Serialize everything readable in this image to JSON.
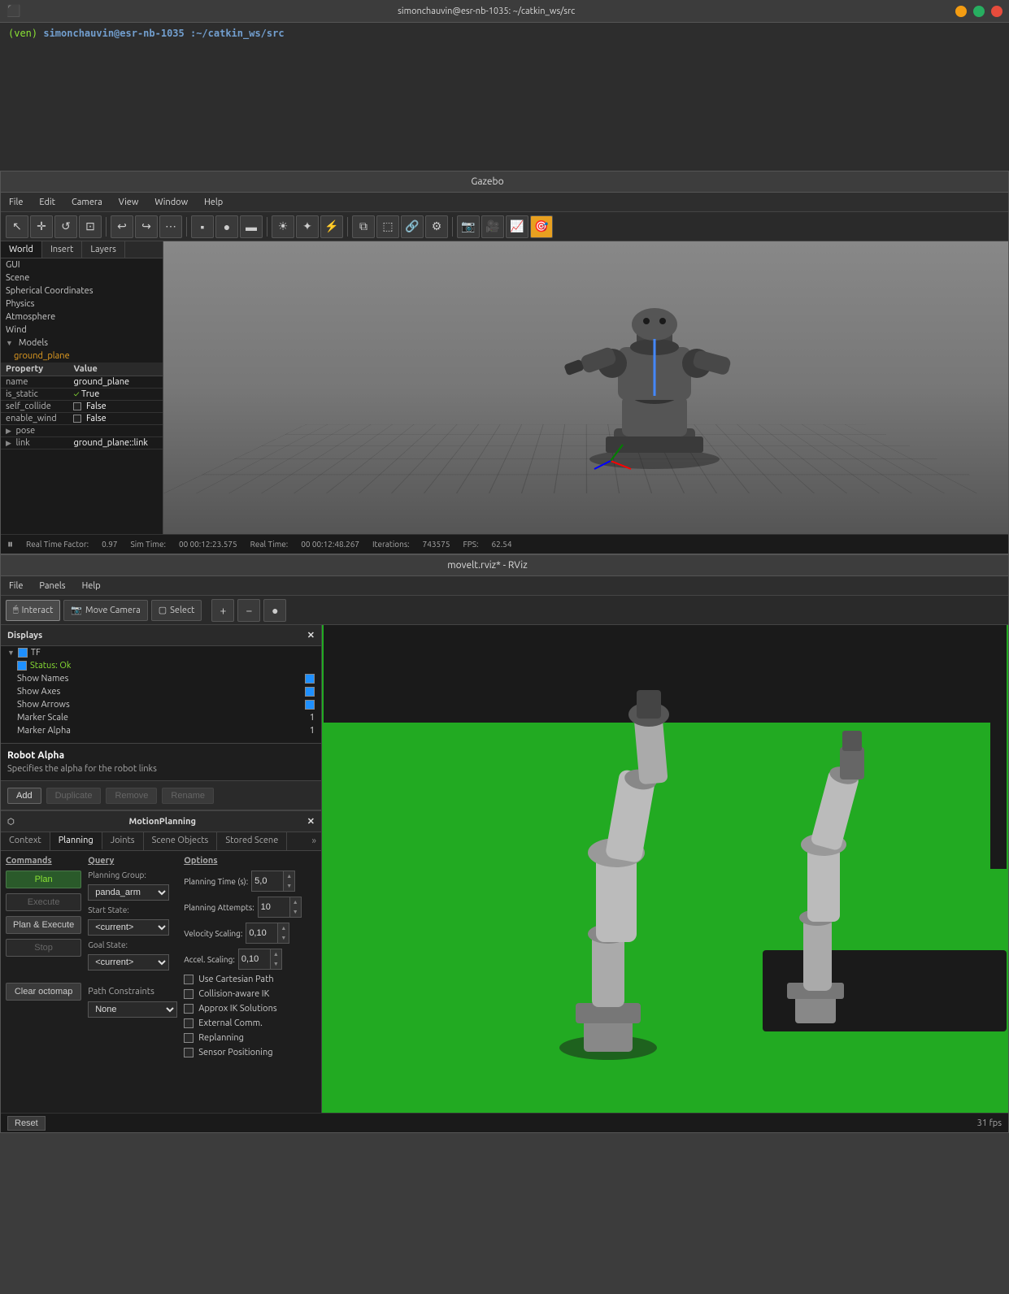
{
  "terminal": {
    "title": "simonchauvin@esr-nb-1035: ~/catkin_ws/src",
    "prompt": "(ven)",
    "user_host": "simonchauvin@esr-nb-1035",
    "path": ":~/catkin_ws/src",
    "cursor": "$"
  },
  "gazebo": {
    "title": "Gazebo",
    "menu": [
      "File",
      "Edit",
      "Camera",
      "View",
      "Window",
      "Help"
    ],
    "tabs": [
      "World",
      "Insert",
      "Layers"
    ],
    "tree": {
      "gui": "GUI",
      "scene": "Scene",
      "spherical_coordinates": "Spherical Coordinates",
      "physics": "Physics",
      "atmosphere": "Atmosphere",
      "wind": "Wind",
      "models": "Models",
      "ground_plane": "ground_plane"
    },
    "properties": {
      "header": [
        "Property",
        "Value"
      ],
      "rows": [
        {
          "prop": "name",
          "val": "ground_plane"
        },
        {
          "prop": "is_static",
          "val": "True",
          "checked": true
        },
        {
          "prop": "self_collide",
          "val": "False",
          "checked": false
        },
        {
          "prop": "enable_wind",
          "val": "False",
          "checked": false
        },
        {
          "prop": "pose",
          "val": "",
          "expandable": true
        },
        {
          "prop": "link",
          "val": "ground_plane::link",
          "expandable": true
        }
      ]
    },
    "statusbar": {
      "play_pause": "▶",
      "real_time_factor_label": "Real Time Factor:",
      "real_time_factor": "0.97",
      "sim_time_label": "Sim Time:",
      "sim_time": "00 00:12:23.575",
      "real_time_label": "Real Time:",
      "real_time": "00 00:12:48.267",
      "iterations_label": "Iterations:",
      "iterations": "743575",
      "fps_label": "FPS:",
      "fps": "62.54"
    }
  },
  "rviz": {
    "title": "movelt.rviz* - RViz",
    "menu": [
      "File",
      "Panels",
      "Help"
    ],
    "tools": [
      "Interact",
      "Move Camera",
      "Select"
    ],
    "tool_icons": [
      "+",
      "−",
      "●"
    ],
    "displays": {
      "header": "Displays",
      "items": [
        {
          "label": "TF",
          "expanded": true,
          "checked": true,
          "indent": 0
        },
        {
          "label": "Status: Ok",
          "checked": true,
          "indent": 1
        },
        {
          "label": "Show Names",
          "checked": true,
          "indent": 1
        },
        {
          "label": "Show Axes",
          "checked": true,
          "indent": 1
        },
        {
          "label": "Show Arrows",
          "checked": true,
          "indent": 1
        },
        {
          "label": "Marker Scale",
          "val": "1",
          "indent": 1
        },
        {
          "label": "Marker Alpha",
          "val": "1",
          "indent": 1
        }
      ]
    },
    "robot_alpha": {
      "title": "Robot Alpha",
      "description": "Specifies the alpha for the robot links"
    },
    "buttons": [
      "Add",
      "Duplicate",
      "Remove",
      "Rename"
    ],
    "motion_planning": {
      "header": "MotionPlanning",
      "tabs": [
        "Context",
        "Planning",
        "Joints",
        "Scene Objects",
        "Stored Scene"
      ],
      "active_tab": "Planning",
      "commands": {
        "label": "Commands",
        "buttons": [
          "Plan",
          "Execute",
          "Plan & Execute",
          "Stop",
          "Clear octomap"
        ]
      },
      "query": {
        "label": "Query",
        "planning_group_label": "Planning Group:",
        "planning_group": "panda_arm",
        "start_state_label": "Start State:",
        "start_state": "<current>",
        "goal_state_label": "Goal State:",
        "goal_state": "<current>"
      },
      "options": {
        "label": "Options",
        "planning_time_label": "Planning Time (s):",
        "planning_time": "5,0",
        "planning_attempts_label": "Planning Attempts:",
        "planning_attempts": "10",
        "velocity_scaling_label": "Velocity Scaling:",
        "velocity_scaling": "0,10",
        "accel_scaling_label": "Accel. Scaling:",
        "accel_scaling": "0,10",
        "checkboxes": [
          {
            "label": "Use Cartesian Path",
            "checked": false
          },
          {
            "label": "Collision-aware IK",
            "checked": false
          },
          {
            "label": "Approx IK Solutions",
            "checked": false
          },
          {
            "label": "External Comm.",
            "checked": false
          },
          {
            "label": "Replanning",
            "checked": false
          },
          {
            "label": "Sensor Positioning",
            "checked": false
          }
        ]
      },
      "path_constraints": {
        "label": "Path Constraints",
        "value": "None"
      }
    },
    "statusbar": {
      "reset_label": "Reset",
      "fps": "31 fps"
    }
  }
}
